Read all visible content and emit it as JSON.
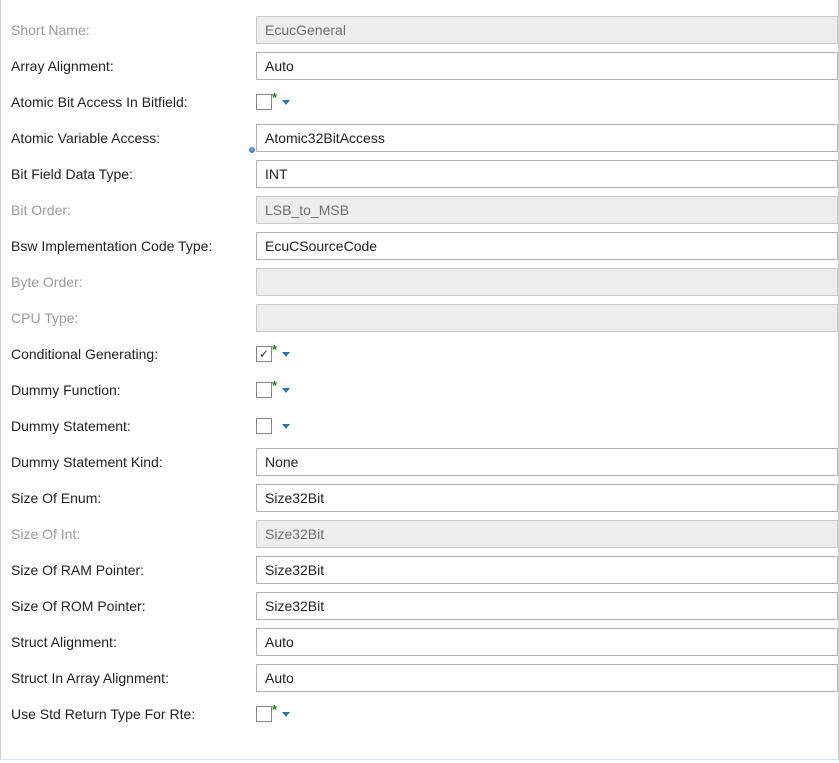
{
  "fields": {
    "shortName": {
      "label": "Short Name:",
      "value": "EcucGeneral"
    },
    "arrayAlignment": {
      "label": "Array Alignment:",
      "value": "Auto"
    },
    "atomicBitAccess": {
      "label": "Atomic Bit Access In Bitfield:",
      "checked": false
    },
    "atomicVarAccess": {
      "label": "Atomic Variable Access:",
      "value": "Atomic32BitAccess"
    },
    "bitFieldDataType": {
      "label": "Bit Field Data Type:",
      "value": "INT"
    },
    "bitOrder": {
      "label": "Bit Order:",
      "value": "LSB_to_MSB"
    },
    "bswImplCodeType": {
      "label": "Bsw Implementation Code Type:",
      "value": "EcuCSourceCode"
    },
    "byteOrder": {
      "label": "Byte Order:",
      "value": "      "
    },
    "cpuType": {
      "label": "CPU Type:",
      "value": "   "
    },
    "condGenerating": {
      "label": "Conditional Generating:",
      "checked": true
    },
    "dummyFunction": {
      "label": "Dummy Function:",
      "checked": false
    },
    "dummyStatement": {
      "label": "Dummy Statement:",
      "checked": false
    },
    "dummyStmtKind": {
      "label": "Dummy Statement Kind:",
      "value": "None"
    },
    "sizeOfEnum": {
      "label": "Size Of Enum:",
      "value": "Size32Bit"
    },
    "sizeOfInt": {
      "label": "Size Of Int:",
      "value": "Size32Bit"
    },
    "sizeOfRamPointer": {
      "label": "Size Of RAM Pointer:",
      "value": "Size32Bit"
    },
    "sizeOfRomPointer": {
      "label": "Size Of ROM Pointer:",
      "value": "Size32Bit"
    },
    "structAlignment": {
      "label": "Struct Alignment:",
      "value": "Auto"
    },
    "structInArrayAl": {
      "label": "Struct In Array Alignment:",
      "value": "Auto"
    },
    "useStdReturnType": {
      "label": "Use Std Return Type For Rte:",
      "checked": false
    }
  },
  "glyphs": {
    "check": "✓"
  }
}
